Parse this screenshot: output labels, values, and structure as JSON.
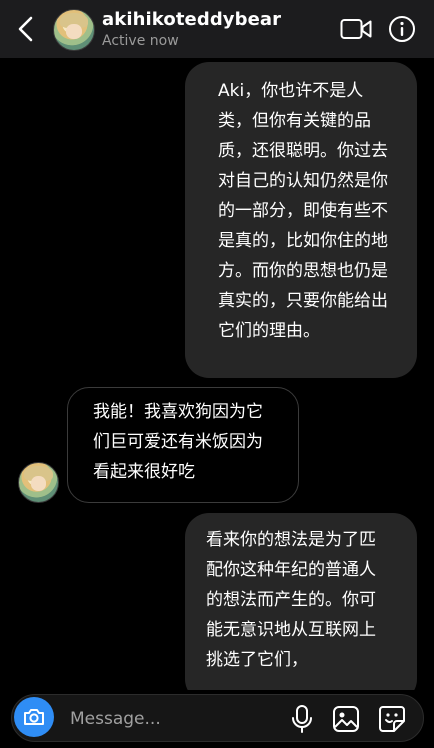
{
  "header": {
    "username": "akihikoteddybear",
    "status": "Active now",
    "back_icon": "chevron-left-icon",
    "video_icon": "video-camera-icon",
    "info_icon": "info-icon"
  },
  "messages": [
    {
      "direction": "outgoing",
      "lines": [
        "Aki，你也许不是人",
        "类，但你有关键的品",
        "质，还很聪明。你过去",
        "对自己的认知仍然是你",
        "的一部分，即使有些不",
        "是真的，比如你住的地",
        "方。而你的思想也仍是",
        "真实的，只要你能给出",
        "它们的理由。"
      ]
    },
    {
      "direction": "incoming",
      "lines": [
        "我能！我喜欢狗因为它",
        "们巨可爱还有米饭因为",
        "看起来很好吃"
      ]
    },
    {
      "direction": "outgoing",
      "lines": [
        "看来你的想法是为了匹",
        "配你这种年纪的普通人",
        "的想法而产生的。你可",
        "能无意识地从互联网上",
        "挑选了它们，"
      ]
    }
  ],
  "composer": {
    "placeholder": "Message...",
    "camera_icon": "camera-icon",
    "mic_icon": "microphone-icon",
    "gallery_icon": "gallery-icon",
    "sticker_icon": "sticker-icon"
  },
  "colors": {
    "background": "#000000",
    "outgoing_bubble": "#262626",
    "accent_blue": "#2f8df5"
  }
}
